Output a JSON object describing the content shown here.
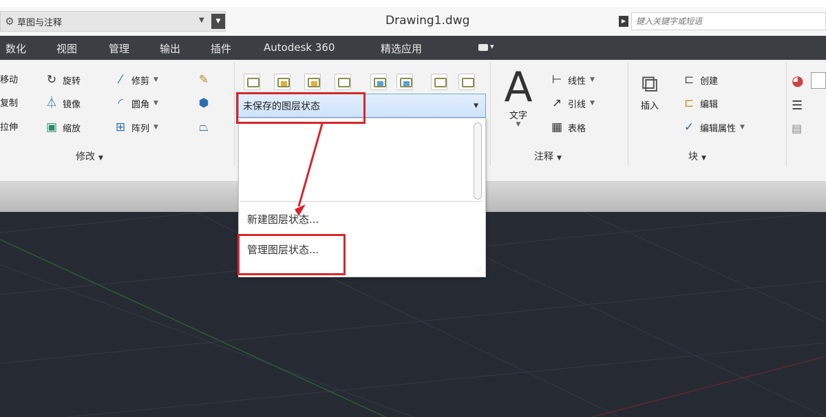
{
  "titlebar": {
    "workspace": "草图与注释",
    "document_title": "Drawing1.dwg",
    "search_placeholder": "键入关键字或短语"
  },
  "tabs": [
    "数化",
    "视图",
    "管理",
    "输出",
    "插件",
    "Autodesk 360",
    "精选应用"
  ],
  "modify_panel": {
    "col1": [
      "移动",
      "复制",
      "拉伸"
    ],
    "col2": [
      "旋转",
      "镜像",
      "缩放"
    ],
    "col3": [
      "修剪",
      "圆角",
      "阵列"
    ],
    "footer": "修改"
  },
  "layers_panel": {
    "current_state": "未保存的图层状态"
  },
  "annotation_panel": {
    "text_label": "文字",
    "linear": "线性",
    "leader": "引线",
    "table": "表格",
    "footer": "注释"
  },
  "block_panel": {
    "insert": "插入",
    "create": "创建",
    "edit": "编辑",
    "edit_attributes": "编辑属性",
    "footer": "块"
  },
  "dropdown": {
    "new_state": "新建图层状态...",
    "manage_states": "管理图层状态..."
  },
  "colors": {
    "tab_bar": "#3b3f44",
    "canvas": "#262a33",
    "highlight": "#d9252a",
    "selection": "#cfe3f9"
  }
}
